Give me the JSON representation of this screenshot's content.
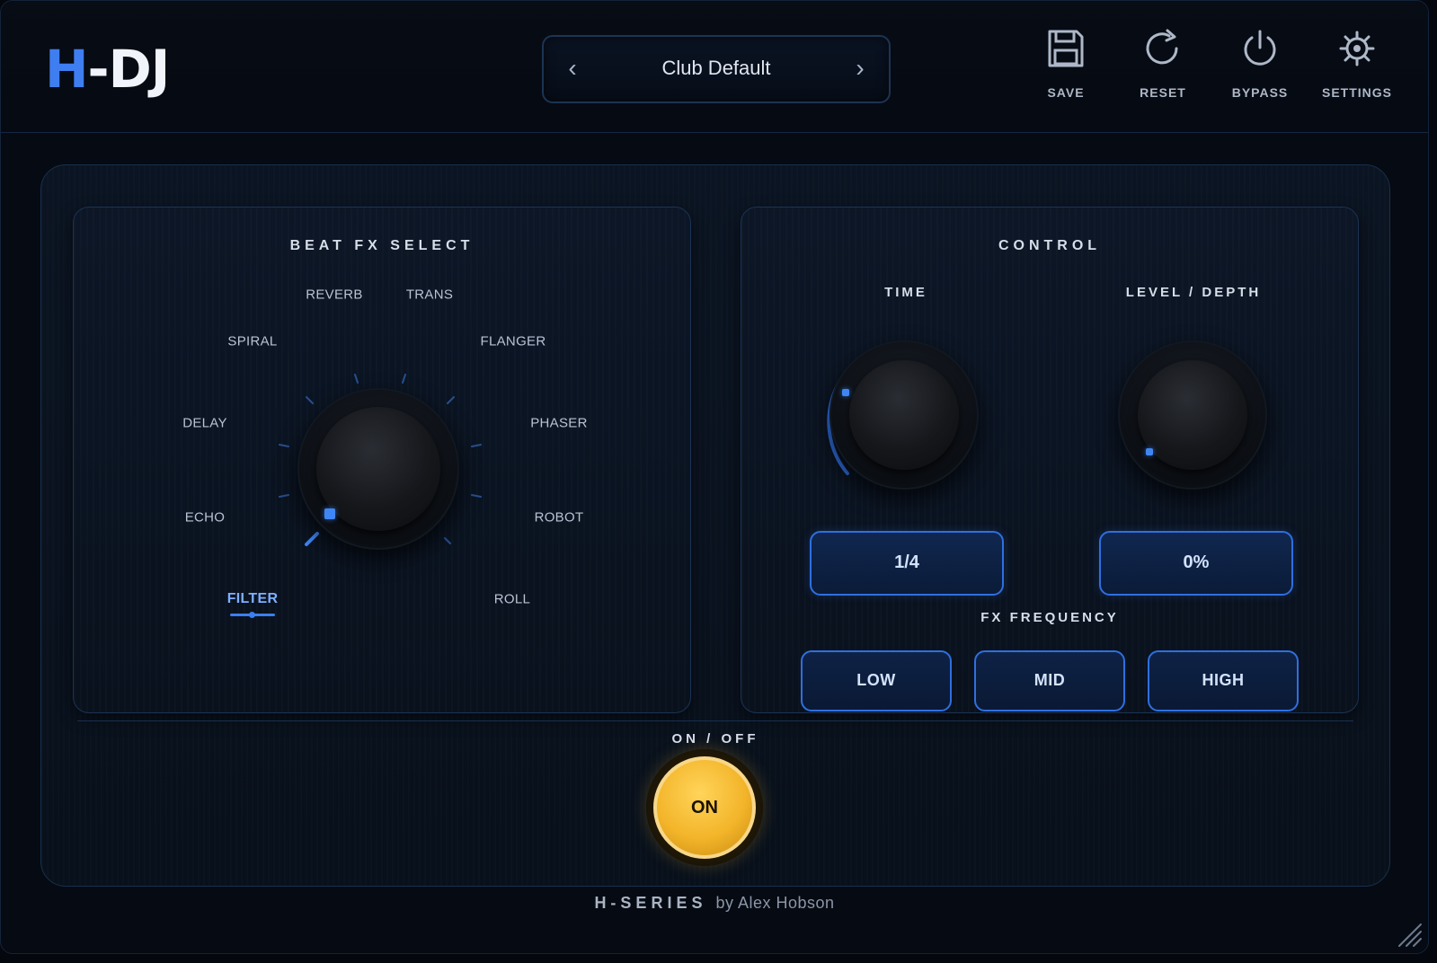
{
  "app": {
    "logo_h": "H",
    "logo_rest": "-DJ"
  },
  "preset": {
    "name": "Club Default",
    "prev_icon": "chevron-left-icon",
    "next_icon": "chevron-right-icon"
  },
  "toolbar": {
    "save": "SAVE",
    "reset": "RESET",
    "bypass": "BYPASS",
    "settings": "SETTINGS"
  },
  "beat_fx": {
    "title": "BEAT FX SELECT",
    "effects": [
      "REVERB",
      "TRANS",
      "SPIRAL",
      "FLANGER",
      "DELAY",
      "PHASER",
      "ECHO",
      "ROBOT",
      "FILTER",
      "ROLL"
    ],
    "selected": "FILTER"
  },
  "control": {
    "title": "CONTROL",
    "time_label": "TIME",
    "time_value": "1/4",
    "level_label": "LEVEL / DEPTH",
    "level_value": "0%",
    "freq_label": "FX FREQUENCY",
    "freq_low": "LOW",
    "freq_mid": "MID",
    "freq_high": "HIGH"
  },
  "power": {
    "label": "ON / OFF",
    "state": "ON"
  },
  "footer": {
    "series": "H-SERIES",
    "by": "by Alex Hobson"
  },
  "colors": {
    "accent": "#3e7ef0",
    "power": "#f3b52a",
    "background": "#060a12"
  }
}
